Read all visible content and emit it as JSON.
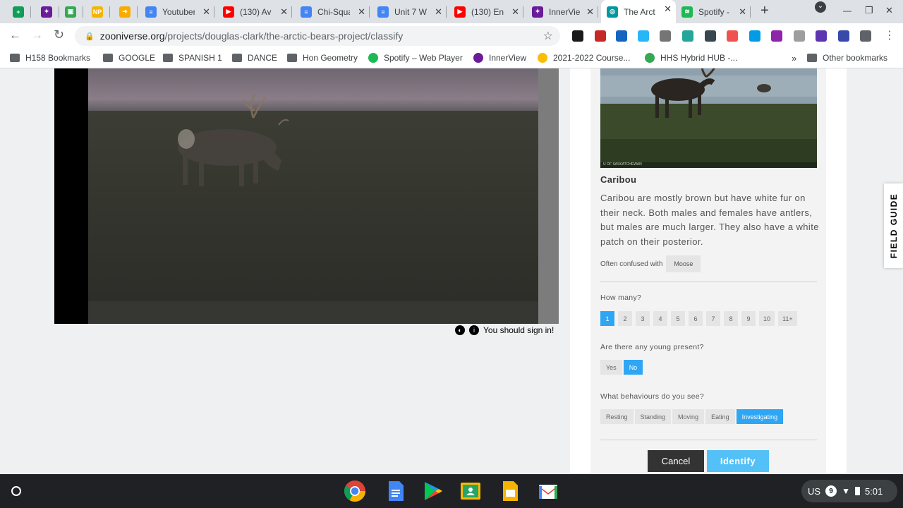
{
  "tabs": [
    {
      "title": "",
      "icon": "sheets-icon",
      "color": "#0f9d58",
      "glyph": "+"
    },
    {
      "title": "",
      "icon": "innerview-icon",
      "color": "#6a1b9a",
      "glyph": "✦"
    },
    {
      "title": "",
      "icon": "classroom-icon",
      "color": "#34a853",
      "glyph": "▣"
    },
    {
      "title": "",
      "icon": "newspaper-icon",
      "color": "#f4b400",
      "glyph": "NP"
    },
    {
      "title": "",
      "icon": "arrow-icon",
      "color": "#f9ab00",
      "glyph": "➜"
    },
    {
      "title": "Youtuber",
      "icon": "docs-icon",
      "color": "#4285f4",
      "glyph": "≡"
    },
    {
      "title": "(130) Av",
      "icon": "youtube-icon",
      "color": "#ff0000",
      "glyph": "▶"
    },
    {
      "title": "Chi-Squa",
      "icon": "docs-icon",
      "color": "#4285f4",
      "glyph": "≡"
    },
    {
      "title": "Unit 7 W",
      "icon": "docs-icon",
      "color": "#4285f4",
      "glyph": "≡"
    },
    {
      "title": "(130) En",
      "icon": "youtube-icon",
      "color": "#ff0000",
      "glyph": "▶"
    },
    {
      "title": "InnerVie",
      "icon": "innerview-icon",
      "color": "#6a1b9a",
      "glyph": "✦"
    },
    {
      "title": "The Arct",
      "icon": "zooniverse-icon",
      "color": "#00979d",
      "glyph": "◎"
    },
    {
      "title": "Spotify -",
      "icon": "spotify-icon",
      "color": "#1db954",
      "glyph": "≋"
    }
  ],
  "close_glyph": "✕",
  "new_tab_glyph": "+",
  "window_controls": {
    "dropdown": "⌄",
    "minimize": "—",
    "restore": "❐",
    "close": "✕"
  },
  "toolbar": {
    "back": "←",
    "forward": "→",
    "reload": "↻",
    "lock": "🔒",
    "url_host": "zooniverse.org",
    "url_path": "/projects/douglas-clark/the-arctic-bears-project/classify",
    "star": "☆",
    "menu": "⋮"
  },
  "extensions": [
    {
      "name": "ext-1",
      "color": "#1a1a1a"
    },
    {
      "name": "ext-2",
      "color": "#c62828"
    },
    {
      "name": "ext-3",
      "color": "#1565c0"
    },
    {
      "name": "ext-4",
      "color": "#29b6f6"
    },
    {
      "name": "ext-5",
      "color": "#757575"
    },
    {
      "name": "ext-6",
      "color": "#26a69a"
    },
    {
      "name": "ext-7",
      "color": "#37474f"
    },
    {
      "name": "ext-8",
      "color": "#ef5350"
    },
    {
      "name": "ext-9",
      "color": "#039be5"
    },
    {
      "name": "ext-10",
      "color": "#8e24aa"
    },
    {
      "name": "ext-11",
      "color": "#9e9e9e"
    },
    {
      "name": "ext-12",
      "color": "#5e35b1"
    },
    {
      "name": "ext-13",
      "color": "#3949ab"
    },
    {
      "name": "ext-14",
      "color": "#5f6368"
    }
  ],
  "bookmarks": [
    {
      "label": "H158 Bookmarks",
      "icon": "folder-icon"
    },
    {
      "label": "GOOGLE",
      "icon": "folder-icon"
    },
    {
      "label": "SPANISH 1",
      "icon": "folder-icon"
    },
    {
      "label": "DANCE",
      "icon": "folder-icon"
    },
    {
      "label": "Hon Geometry",
      "icon": "folder-icon"
    },
    {
      "label": "Spotify – Web Player",
      "icon": "spotify-icon"
    },
    {
      "label": "InnerView",
      "icon": "innerview-icon"
    },
    {
      "label": "2021-2022 Course...",
      "icon": "drive-icon"
    },
    {
      "label": "HHS Hybrid HUB -...",
      "icon": "classroom-icon"
    }
  ],
  "bookmarks_overflow": "»",
  "other_bookmarks": "Other bookmarks",
  "subject": {
    "sign_in": "You should sign in!"
  },
  "field_guide": {
    "photo_caption": "U OF SASKATCHEWAN",
    "title": "Caribou",
    "description": "Caribou are mostly brown but have white fur on their neck. Both males and females have antlers, but males are much larger. They also have a white patch on their posterior.",
    "confused_label": "Often confused with",
    "confused_with": "Moose",
    "tab_label": "FIELD GUIDE"
  },
  "questions": {
    "how_many": {
      "label": "How many?",
      "options": [
        "1",
        "2",
        "3",
        "4",
        "5",
        "6",
        "7",
        "8",
        "9",
        "10",
        "11+"
      ],
      "selected": "1"
    },
    "young": {
      "label": "Are there any young present?",
      "options": [
        "Yes",
        "No"
      ],
      "selected": "No"
    },
    "behaviours": {
      "label": "What behaviours do you see?",
      "options": [
        "Resting",
        "Standing",
        "Moving",
        "Eating",
        "Investigating"
      ],
      "selected": "Investigating"
    }
  },
  "actions": {
    "cancel": "Cancel",
    "identify": "Identify"
  },
  "shelf": {
    "apps": [
      {
        "name": "chrome-app"
      },
      {
        "name": "docs-app"
      },
      {
        "name": "play-store-app"
      },
      {
        "name": "classroom-app"
      },
      {
        "name": "slides-app"
      },
      {
        "name": "gmail-app"
      }
    ],
    "keyboard": "US",
    "notifications": "9",
    "time": "5:01"
  },
  "colors": {
    "accent": "#2ea6f4",
    "identify": "#53c1f7",
    "cancel": "#333333"
  }
}
